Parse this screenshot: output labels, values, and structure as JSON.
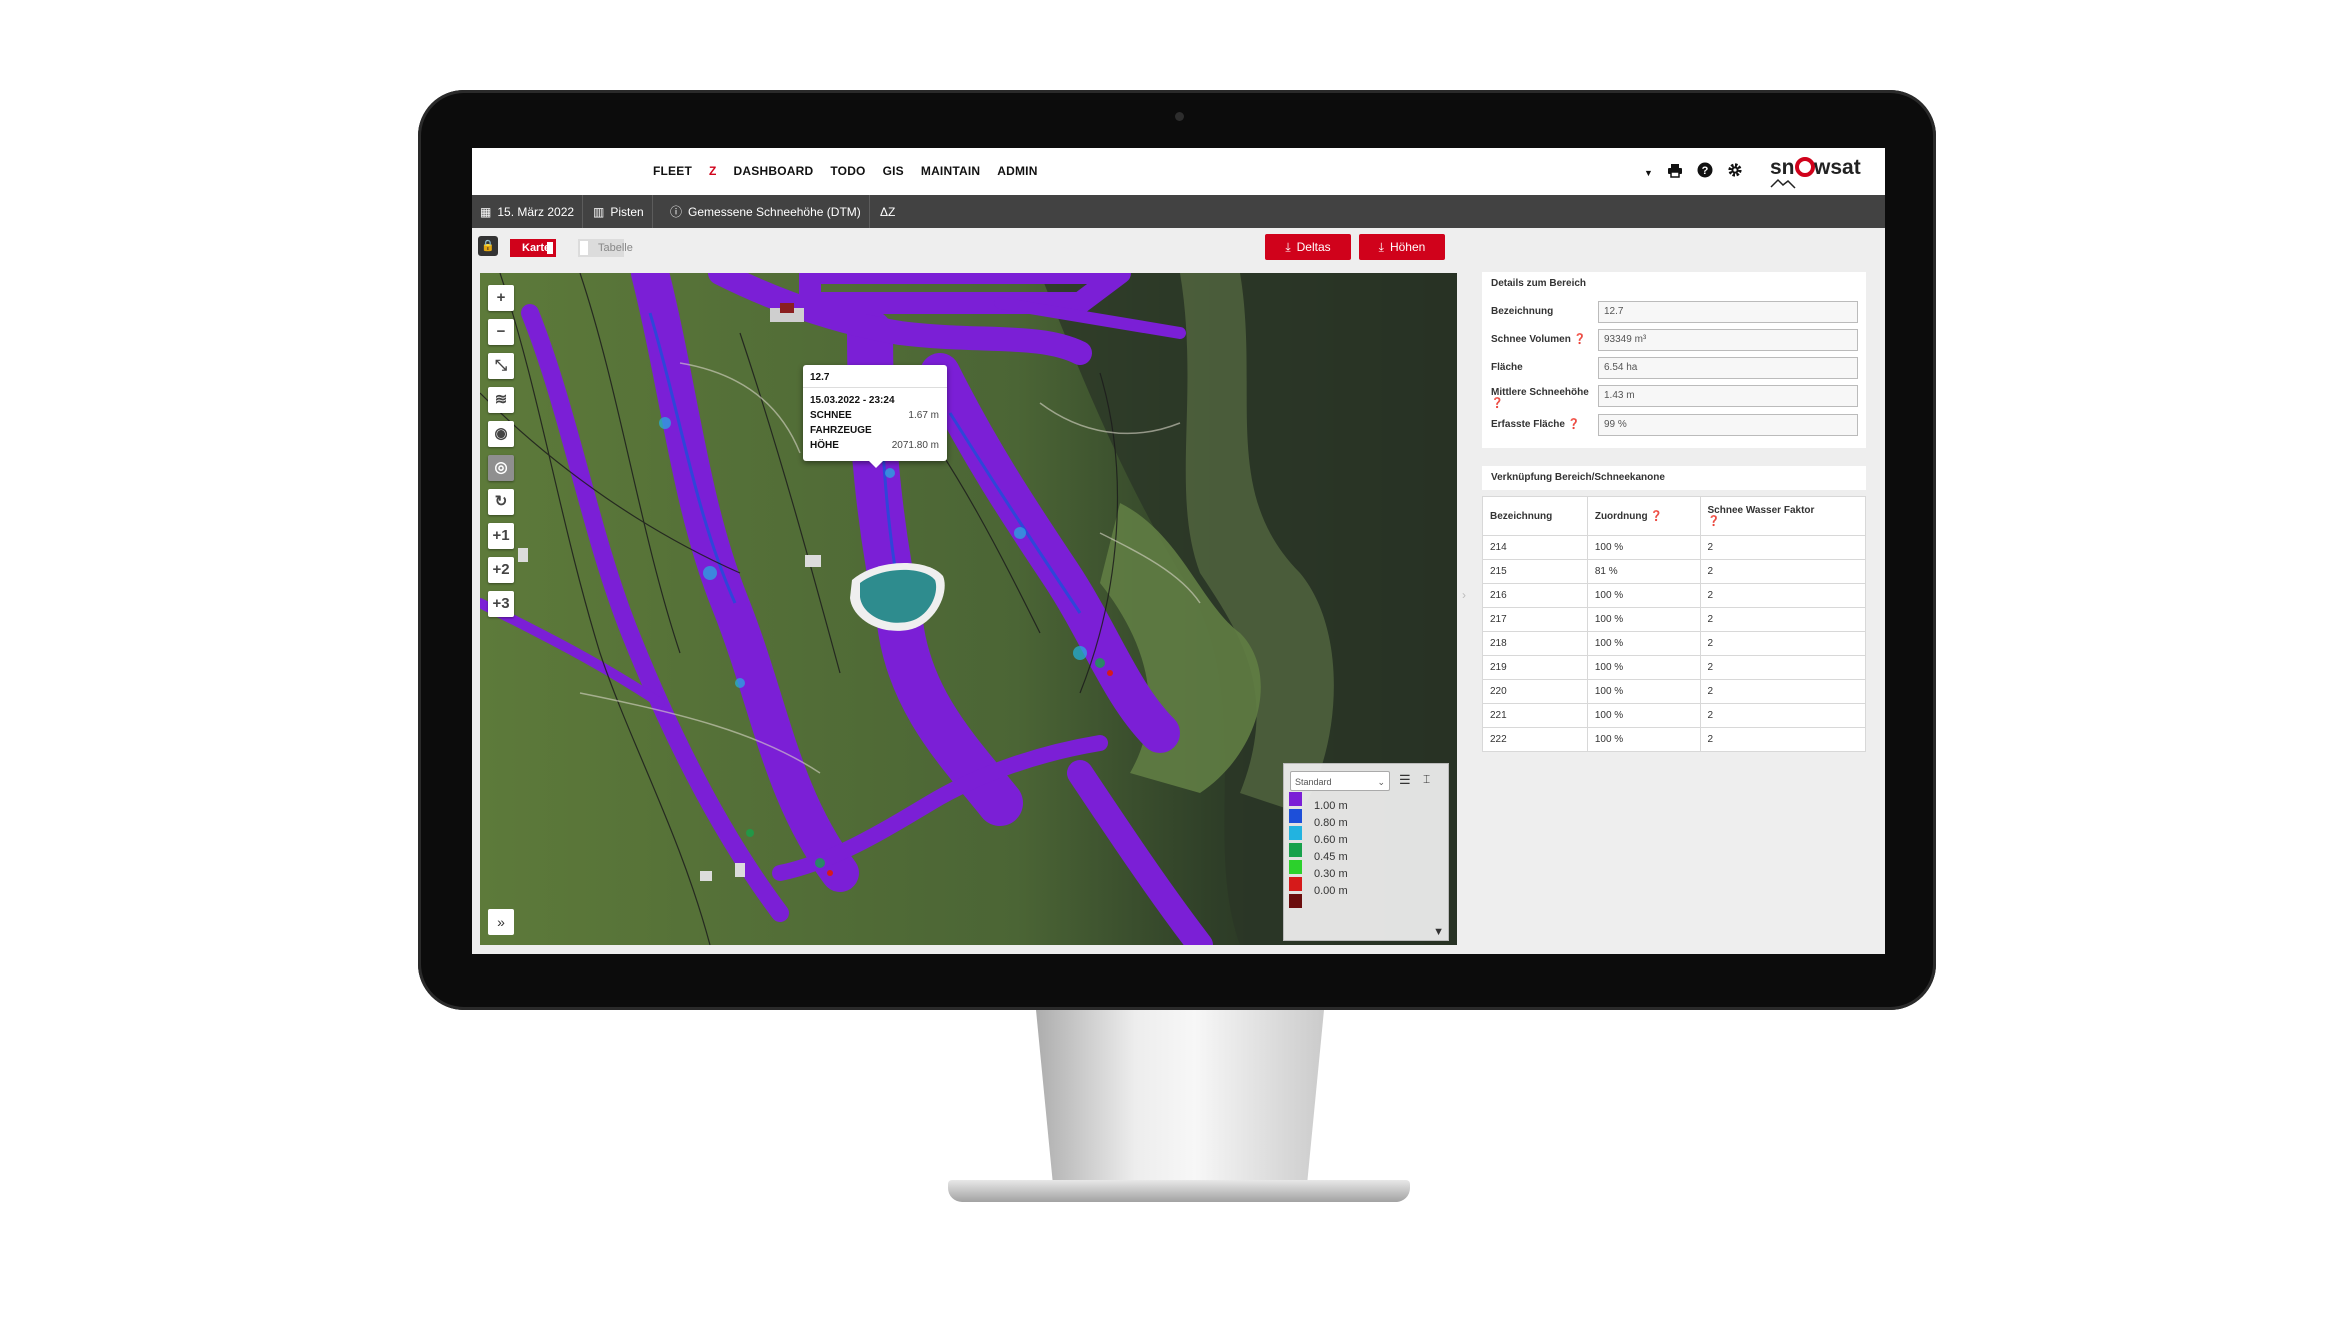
{
  "nav": {
    "items": [
      "FLEET",
      "Z",
      "DASHBOARD",
      "TODO",
      "GIS",
      "MAINTAIN",
      "ADMIN"
    ]
  },
  "topbar": {
    "dropdown_icon": "caret-down-icon",
    "icons": [
      "print-icon",
      "help-icon",
      "gear-icon"
    ],
    "logo_text": "snowsat"
  },
  "filters": {
    "date": "15. März 2022",
    "pisten": "Pisten",
    "layer": "Gemessene Schneehöhe (DTM)",
    "delta_icon": "ΔZ"
  },
  "toolbar": {
    "karte": "Karte",
    "tabelle": "Tabelle",
    "deltas": "Deltas",
    "hoehen": "Höhen"
  },
  "map": {
    "controls": [
      "+",
      "−",
      "⤡",
      "≋",
      "◉",
      "◎",
      "↻",
      "+1",
      "+2",
      "+3"
    ],
    "expand": "»",
    "popup": {
      "title": "12.7",
      "datetime": "15.03.2022 - 23:24",
      "schnee_label": "SCHNEE",
      "schnee_value": "1.67 m",
      "fahrzeuge_label": "FAHRZEUGE",
      "hoehe_label": "HÖHE",
      "hoehe_value": "2071.80 m"
    },
    "legend": {
      "selected": "Standard",
      "colors": [
        "#7b1fd6",
        "#1d4fd9",
        "#22b3e0",
        "#17a14b",
        "#2cd12c",
        "#d61a1a",
        "#6b0d0d"
      ],
      "labels": [
        "1.00 m",
        "0.80 m",
        "0.60 m",
        "0.45 m",
        "0.30 m",
        "0.00 m"
      ]
    }
  },
  "details": {
    "title": "Details zum Bereich",
    "fields": [
      {
        "label": "Bezeichnung",
        "value": "12.7"
      },
      {
        "label": "Schnee Volumen",
        "value": "93349 m³"
      },
      {
        "label": "Fläche",
        "value": "6.54 ha"
      },
      {
        "label": "Mittlere Schneehöhe",
        "value": "1.43 m"
      },
      {
        "label": "Erfasste Fläche",
        "value": "99 %"
      }
    ]
  },
  "verknuepfung": {
    "title": "Verknüpfung Bereich/Schneekanone",
    "headers": [
      "Bezeichnung",
      "Zuordnung",
      "Schnee Wasser Faktor"
    ],
    "rows": [
      [
        "214",
        "100 %",
        "2"
      ],
      [
        "215",
        "81 %",
        "2"
      ],
      [
        "216",
        "100 %",
        "2"
      ],
      [
        "217",
        "100 %",
        "2"
      ],
      [
        "218",
        "100 %",
        "2"
      ],
      [
        "219",
        "100 %",
        "2"
      ],
      [
        "220",
        "100 %",
        "2"
      ],
      [
        "221",
        "100 %",
        "2"
      ],
      [
        "222",
        "100 %",
        "2"
      ]
    ]
  }
}
